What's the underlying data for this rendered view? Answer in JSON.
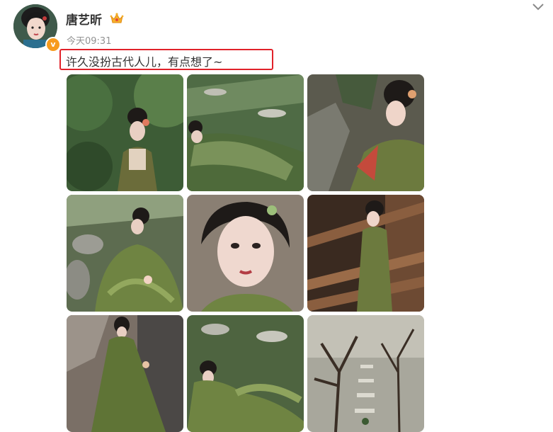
{
  "post": {
    "author": {
      "name": "唐艺昕",
      "avatar_icon": "avatar-portrait",
      "verified_icon": "verified-v-badge",
      "verified_label": "v",
      "member_icon": "crown-icon"
    },
    "timestamp": "今天09:31",
    "text": "许久没扮古代人儿，有点想了~",
    "highlight_color": "#e1222a",
    "menu_icon": "chevron-down-icon",
    "photos": [
      {
        "name": "photo-1",
        "theme": "woman-in-green-forest"
      },
      {
        "name": "photo-2",
        "theme": "green-robe-lying-on-steps"
      },
      {
        "name": "photo-3",
        "theme": "woman-reclining-on-rocks"
      },
      {
        "name": "photo-4",
        "theme": "green-gown-on-stones"
      },
      {
        "name": "photo-5",
        "theme": "close-up-portrait"
      },
      {
        "name": "photo-6",
        "theme": "woman-on-wooden-balcony"
      },
      {
        "name": "photo-7",
        "theme": "green-cloak-back-view"
      },
      {
        "name": "photo-8",
        "theme": "green-robe-sitting"
      },
      {
        "name": "photo-9",
        "theme": "bare-tree-stone-path"
      }
    ]
  }
}
